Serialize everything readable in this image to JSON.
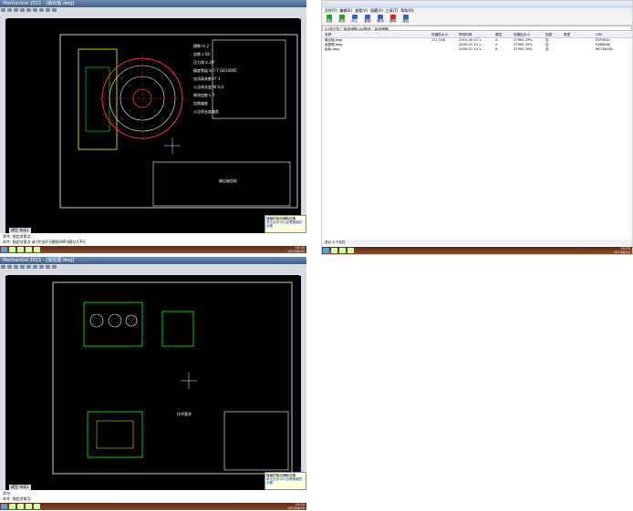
{
  "cad_top": {
    "title": "Mechanical 2011 - [输出轴.dwg]",
    "toolbar_fields": [
      "Standard",
      "Standard",
      "Standard",
      "ByLayer",
      "ByLayer",
      "ByLayer"
    ],
    "command_lines": [
      "命令: 指定对角点:",
      "命令: 指定对角点 或 [栏选(F)/圈围(WP)/圈交(CP)]:"
    ],
    "tabs": [
      "模型",
      "布局1"
    ],
    "table_rows": [
      [
        "模数",
        "m",
        "2"
      ],
      [
        "齿数",
        "z",
        "58"
      ],
      [
        "压力角",
        "α",
        "20°"
      ],
      [
        "精度等级",
        "",
        "8-7-7 GB10095"
      ],
      [
        "齿顶高系数",
        "h*",
        "1"
      ],
      [
        "公法线长度",
        "W",
        "0.0"
      ],
      [
        "跨测齿数",
        "k",
        "7"
      ],
      [
        "齿厚偏差",
        "",
        ""
      ],
      [
        "公法线长度偏差",
        "",
        ""
      ]
    ],
    "title_block_name": "输出轴齿轮"
  },
  "cad_bottom": {
    "title": "Mechanical 2011 - [装配图.dwg]",
    "toolbar_fields": [
      "Standard",
      "Standard",
      "Standard",
      "ByLayer",
      "ByLayer",
      "ByLayer"
    ],
    "command_lines": [
      "命令:",
      "命令: 指定对角点:"
    ],
    "tabs": [
      "模型",
      "布局1"
    ],
    "tech_req_title": "技术要求"
  },
  "explorer": {
    "title": "",
    "menu": [
      "文件(F)",
      "编辑(E)",
      "查看(V)",
      "收藏(A)",
      "工具(T)",
      "帮助(H)"
    ],
    "tools": [
      {
        "label": "后退",
        "color": "#2a9d2a"
      },
      {
        "label": "前进",
        "color": "#2a9d2a"
      },
      {
        "label": "向上",
        "color": "#3367b5"
      },
      {
        "label": "复制",
        "color": "#3367b5"
      },
      {
        "label": "移动",
        "color": "#3367b5"
      },
      {
        "label": "删除",
        "color": "#cc2222"
      },
      {
        "label": "属性",
        "color": "#3367b5"
      }
    ],
    "address": "D:\\原文件\\二级减速器CAD图纸\\二级减速器\\",
    "columns": [
      "名称",
      "压缩前大小",
      "修改时间",
      "属性",
      "压缩后大小",
      "加密",
      "类型",
      "CRC"
    ],
    "files": [
      {
        "name": "输出轴.dwg",
        "size": "121 536",
        "date": "2010-09-12 1...",
        "attr": "A",
        "packed": "27994 29%",
        "enc": "否",
        "crc": "E3F9932"
      },
      {
        "name": "装配图.dwg",
        "size": "",
        "date": "2009-07-14 1...",
        "attr": "A",
        "packed": "27994 29%",
        "enc": "否",
        "crc": "E4B6480"
      },
      {
        "name": "齿轮.dwg",
        "size": "",
        "date": "2009-07-14 1...",
        "attr": "A",
        "packed": "27994 29%",
        "enc": "否",
        "crc": "9D7AA091"
      }
    ],
    "status": "总计 3 个文件"
  },
  "balloons": [
    {
      "title": "隐藏的驱动器和设备",
      "link": "单击此处可以查看隐藏的设备"
    },
    {
      "title": "隐藏的驱动器和设备",
      "link": "单击此处可以查看隐藏的设备"
    }
  ],
  "clocks": [
    {
      "time": "10:04",
      "date": "2013/6/20"
    },
    {
      "time": "10:03",
      "date": "2013/6/20"
    },
    {
      "time": "10:04",
      "date": "2013/6/20"
    }
  ]
}
